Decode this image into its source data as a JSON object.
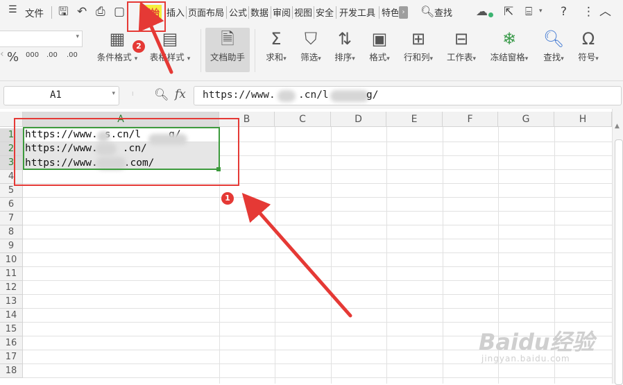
{
  "menu": {
    "file": "文件",
    "tabs": [
      "开始",
      "插入",
      "页面布局",
      "公式",
      "数据",
      "审阅",
      "视图",
      "安全",
      "开发工具",
      "特色"
    ],
    "search": "查找"
  },
  "ribbon": {
    "number_format_group": {
      "percent": "%",
      "thousands": "000",
      "inc_decimal": ".00",
      "dec_decimal": ".00"
    },
    "conditional_format": "条件格式",
    "table_style": "表格样式",
    "doc_assistant": "文档助手",
    "sum": "求和",
    "filter": "筛选",
    "sort": "排序",
    "format": "格式",
    "row_col": "行和列",
    "worksheet": "工作表",
    "freeze": "冻结窗格",
    "find": "查找",
    "symbol": "符号"
  },
  "formula_bar": {
    "cell_ref": "A1",
    "fx": "fx",
    "value_start": "https://www.",
    "value_mid": ".cn/l",
    "value_end": "g/"
  },
  "columns": [
    "A",
    "B",
    "C",
    "D",
    "E",
    "F",
    "G",
    "H"
  ],
  "rows": [
    "1",
    "2",
    "3",
    "4",
    "5",
    "6",
    "7",
    "8",
    "9",
    "10",
    "11",
    "12",
    "13",
    "14",
    "15",
    "16",
    "17",
    "18"
  ],
  "cells": {
    "a1": {
      "start": "https://www.",
      "mid": "s.cn/l",
      "end": "g/"
    },
    "a2": {
      "start": "https://www.",
      "end": ".cn/"
    },
    "a3": {
      "start": "https://www.",
      "end": ".com/"
    }
  },
  "annotations": {
    "badge1": "1",
    "badge2": "2"
  },
  "watermark": {
    "brand": "Baidu经验",
    "url": "jingyan.baidu.com"
  }
}
